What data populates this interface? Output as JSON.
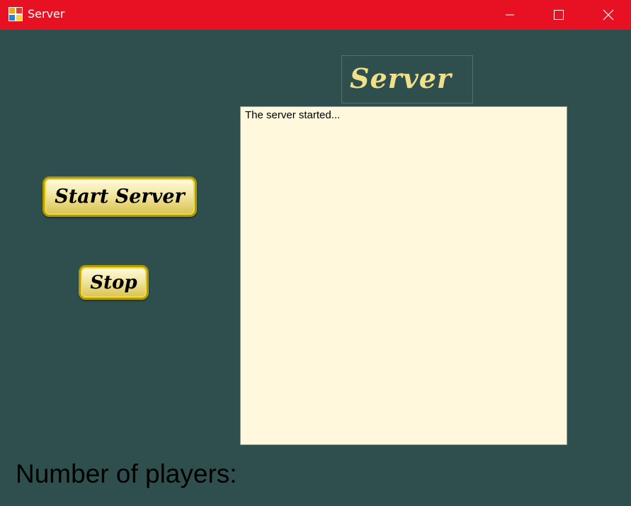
{
  "window": {
    "title": "Server",
    "titlebar_color": "#e81123",
    "icons": {
      "app": "app-icon",
      "minimize": "minimize-icon",
      "maximize": "maximize-icon",
      "close": "close-icon"
    }
  },
  "main": {
    "background_color": "#2f4f4f",
    "header_label": "Server",
    "start_button_label": "Start Server",
    "stop_button_label": "Stop",
    "log_text": "The server started...",
    "players_label": "Number of players:"
  }
}
